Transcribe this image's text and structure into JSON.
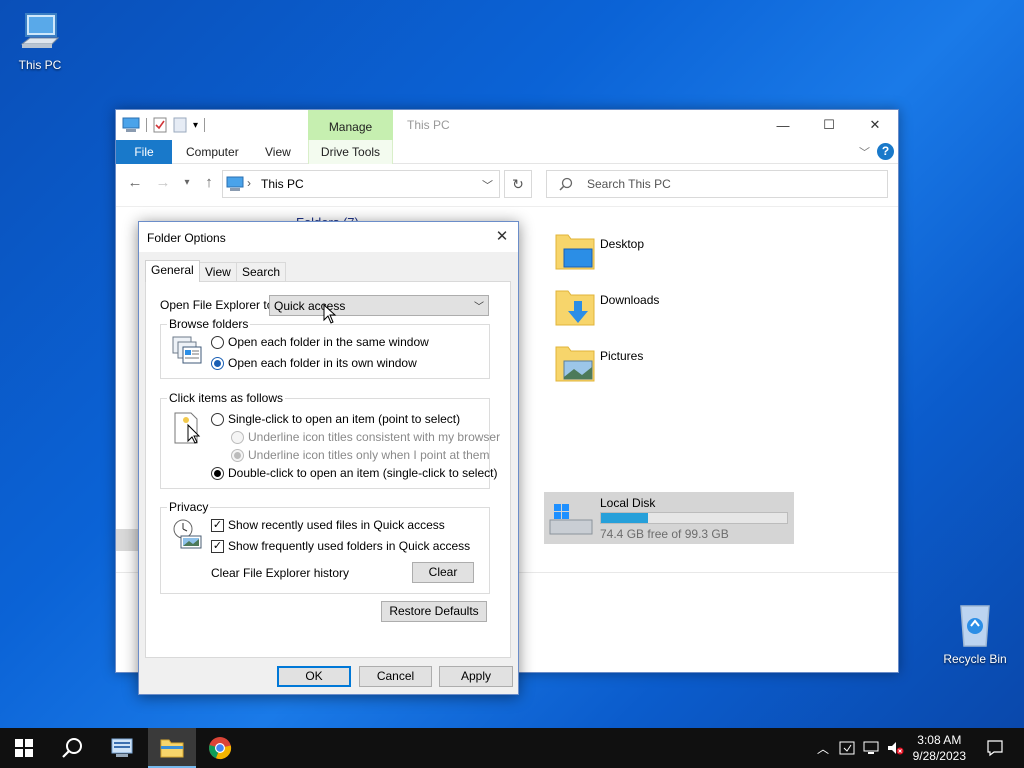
{
  "desktop": {
    "this_pc_label": "This PC",
    "recycle_bin_label": "Recycle Bin"
  },
  "explorer": {
    "title": "This PC",
    "manage_tab": "Manage",
    "ribbon_tabs": {
      "file": "File",
      "computer": "Computer",
      "view": "View",
      "drive_tools": "Drive Tools"
    },
    "help": "?",
    "address": "This PC",
    "search_placeholder": "Search This PC",
    "folders_heading": "Folders (7)",
    "folders": [
      {
        "name": "Desktop"
      },
      {
        "name": "Downloads"
      },
      {
        "name": "Pictures"
      }
    ],
    "disk": {
      "name": "Local Disk",
      "free_text": "74.4 GB free of 99.3 GB",
      "used_fraction": 0.25
    }
  },
  "dialog": {
    "title": "Folder Options",
    "tabs": [
      "General",
      "View",
      "Search"
    ],
    "open_to_label": "Open File Explorer to:",
    "open_to_value": "Quick access",
    "browse_group": {
      "legend": "Browse folders",
      "options": [
        "Open each folder in the same window",
        "Open each folder in its own window"
      ],
      "selected": 1
    },
    "click_group": {
      "legend": "Click items as follows",
      "single": "Single-click to open an item (point to select)",
      "underline_browser": "Underline icon titles consistent with my browser",
      "underline_point": "Underline icon titles only when I point at them",
      "double": "Double-click to open an item (single-click to select)"
    },
    "privacy_group": {
      "legend": "Privacy",
      "recent_files": "Show recently used files in Quick access",
      "frequent_folders": "Show frequently used folders in Quick access",
      "clear_label": "Clear File Explorer history",
      "clear_button": "Clear"
    },
    "restore_defaults": "Restore Defaults",
    "ok": "OK",
    "cancel": "Cancel",
    "apply": "Apply"
  },
  "taskbar": {
    "time": "3:08 AM",
    "date": "9/28/2023"
  },
  "colors": {
    "accent": "#1979ca",
    "manage_tab": "#c6efb0",
    "disk_fill": "#26a0da"
  }
}
